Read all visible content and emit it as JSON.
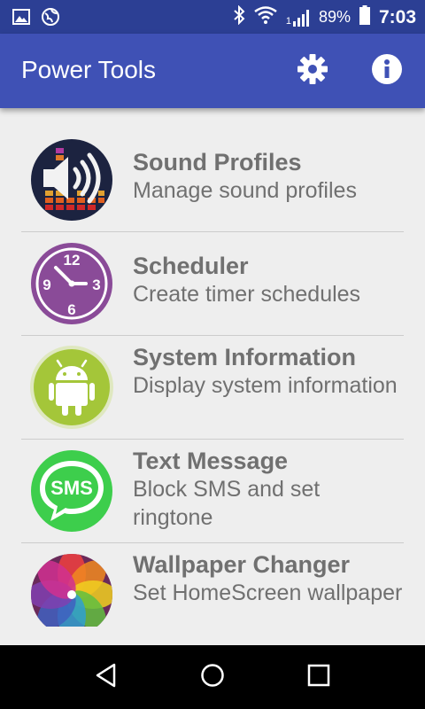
{
  "status": {
    "battery": "89%",
    "time": "7:03",
    "signal_label": "1"
  },
  "app": {
    "title": "Power Tools",
    "settings_icon": "gear-icon",
    "info_icon": "info-icon"
  },
  "items": [
    {
      "title": "Sound Profiles",
      "subtitle": "Manage sound profiles",
      "icon": "sound-profiles-icon"
    },
    {
      "title": "Scheduler",
      "subtitle": "Create timer schedules",
      "icon": "clock-icon"
    },
    {
      "title": "System Information",
      "subtitle": "Display system information",
      "icon": "android-icon"
    },
    {
      "title": "Text Message",
      "subtitle": "Block SMS and set ringtone",
      "icon": "sms-icon"
    },
    {
      "title": "Wallpaper Changer",
      "subtitle": "Set HomeScreen wallpaper",
      "icon": "wallpaper-icon"
    }
  ],
  "clock": {
    "n12": "12",
    "n3": "3",
    "n6": "6",
    "n9": "9"
  },
  "sms_label": "SMS",
  "colors": {
    "statusbar": "#2c3f94",
    "toolbar": "#3f51b5",
    "background": "#eeeeee",
    "text": "#707070"
  }
}
